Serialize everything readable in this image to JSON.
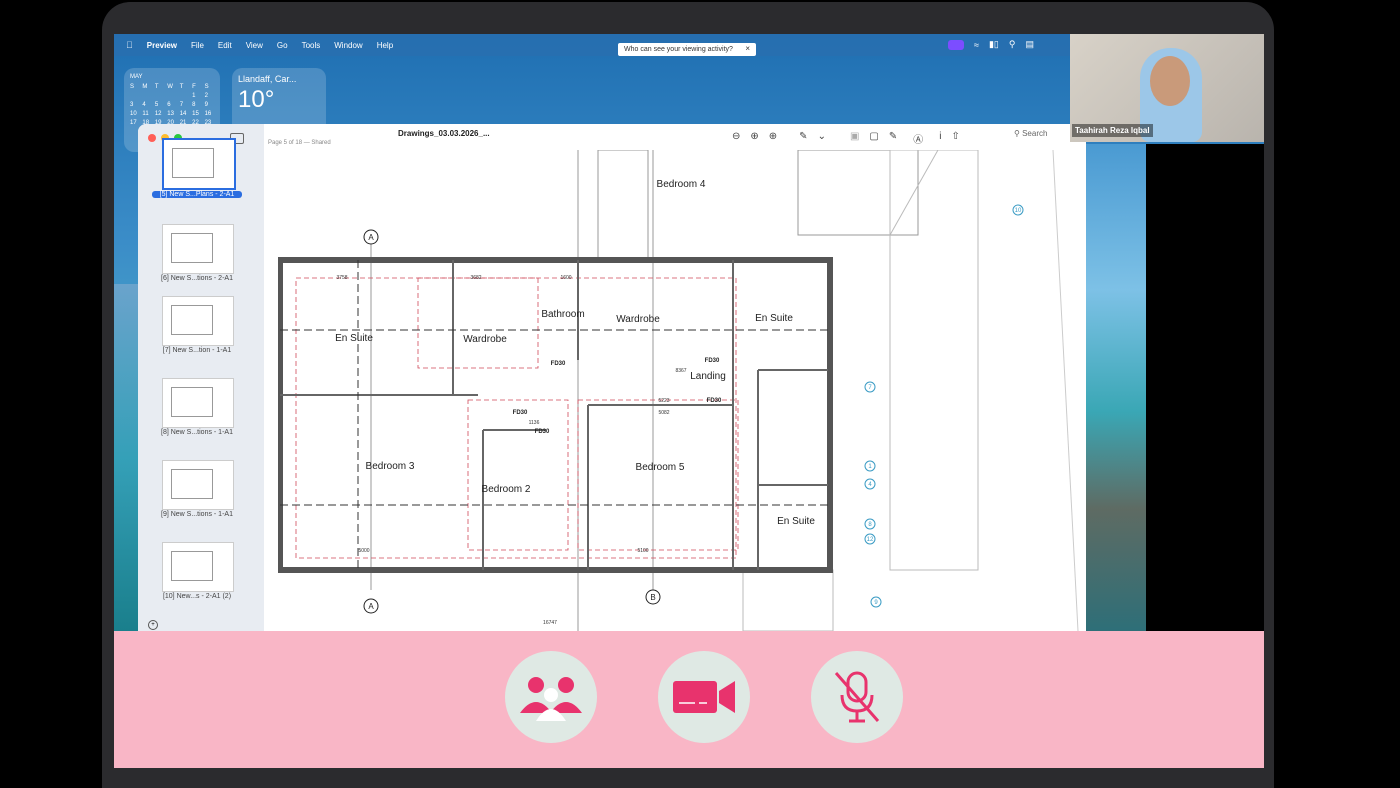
{
  "menubar": {
    "app_name": "Preview",
    "items": [
      "File",
      "Edit",
      "View",
      "Go",
      "Tools",
      "Window",
      "Help"
    ],
    "privacy_notice": "Who can see your viewing activity?"
  },
  "widgets": {
    "calendar_month": "MAY",
    "calendar_days": [
      "S",
      "M",
      "T",
      "W",
      "T",
      "F",
      "S"
    ],
    "calendar_rows": [
      [
        "",
        "",
        "",
        "",
        "",
        "1",
        "2"
      ],
      [
        "3",
        "4",
        "5",
        "6",
        "7",
        "8",
        "9"
      ],
      [
        "10",
        "11",
        "12",
        "13",
        "14",
        "15",
        "16"
      ],
      [
        "17",
        "18",
        "19",
        "20",
        "21",
        "22",
        "23"
      ]
    ],
    "weather_city": "Llandaff, Car...",
    "weather_temp": "10°"
  },
  "preview": {
    "doc_title": "Drawings_03.03.2026_...",
    "page_info": "Page 5 of 18 — Shared",
    "search_placeholder": "Search",
    "thumbnails": [
      {
        "label": "[5] New S...Plans - 2-A1",
        "selected": true
      },
      {
        "label": "[6] New S...tions - 2-A1",
        "selected": false
      },
      {
        "label": "[7] New S...tion - 1-A1",
        "selected": false
      },
      {
        "label": "[8] New S...tions - 1-A1",
        "selected": false
      },
      {
        "label": "[9] New S...tions - 1-A1",
        "selected": false
      },
      {
        "label": "[10] New...s - 2-A1 (2)",
        "selected": false
      }
    ]
  },
  "floorplan": {
    "rooms": [
      "Bedroom 4",
      "En Suite",
      "Wardrobe",
      "Bathroom",
      "Wardrobe",
      "En Suite",
      "Landing",
      "Bedroom 3",
      "Bedroom 2",
      "Bedroom 5",
      "En Suite"
    ],
    "fire_doors": [
      "FD30",
      "FD30",
      "FD30",
      "FD30",
      "FD30"
    ],
    "grid_markers": [
      "A",
      "A",
      "B"
    ],
    "callouts": [
      "10",
      "7",
      "1",
      "4",
      "8",
      "12",
      "9"
    ],
    "dimensions": [
      "3758",
      "3682",
      "1600",
      "16747",
      "5000",
      "5100",
      "8367",
      "5223",
      "5082",
      "1136"
    ]
  },
  "webcam": {
    "participant_name": "Taahirah Reza Iqbal"
  },
  "controls": {
    "participants_icon": "participants-icon",
    "camera_icon": "video-camera-icon",
    "mic_icon": "microphone-muted-icon",
    "accent": "#e8336d"
  }
}
